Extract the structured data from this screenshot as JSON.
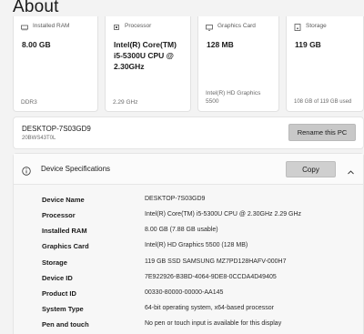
{
  "page": {
    "title": "About"
  },
  "cards": [
    {
      "icon": "memory-icon",
      "label": "Installed RAM",
      "value_lines": [
        "8.00 GB"
      ],
      "sub_lines": [
        "DDR3"
      ]
    },
    {
      "icon": "processor-icon",
      "label": "Processor",
      "value_lines": [
        "Intel(R) Core(TM)",
        "i5-5300U CPU @",
        "2.30GHz"
      ],
      "sub_lines": [
        "2.29 GHz"
      ]
    },
    {
      "icon": "graphics-card-icon",
      "label": "Graphics Card",
      "value_lines": [
        "128 MB"
      ],
      "sub_lines": [
        "Intel(R) HD Graphics",
        "5500"
      ]
    },
    {
      "icon": "storage-icon",
      "label": "Storage",
      "value_lines": [
        "119 GB"
      ],
      "sub_lines": [
        "108 GB of 119 GB used"
      ]
    }
  ],
  "pc": {
    "name": "DESKTOP-7S03GD9",
    "model": "20BWS43T0L",
    "rename_label": "Rename this PC"
  },
  "device_specs": {
    "title": "Device Specifications",
    "copy_label": "Copy",
    "rows": [
      {
        "key": "Device Name",
        "value": "DESKTOP-7S03GD9"
      },
      {
        "key": "Processor",
        "value": "Intel(R) Core(TM) i5-5300U CPU @ 2.30GHz   2.29 GHz"
      },
      {
        "key": "Installed RAM",
        "value": "8.00 GB (7.88 GB usable)"
      },
      {
        "key": "Graphics Card",
        "value": "Intel(R) HD Graphics 5500 (128 MB)"
      },
      {
        "key": "Storage",
        "value": "119 GB SSD SAMSUNG MZ7PD128HAFV-000H7"
      },
      {
        "key": "Device ID",
        "value": "7E922926-B3BD-4064-9DE8-0CCDA4D49405"
      },
      {
        "key": "Product ID",
        "value": "00330-80000-00000-AA145"
      },
      {
        "key": "System Type",
        "value": "64-bit operating system, x64-based processor"
      },
      {
        "key": "Pen and touch",
        "value": "No pen or touch input is available for this display"
      }
    ]
  }
}
